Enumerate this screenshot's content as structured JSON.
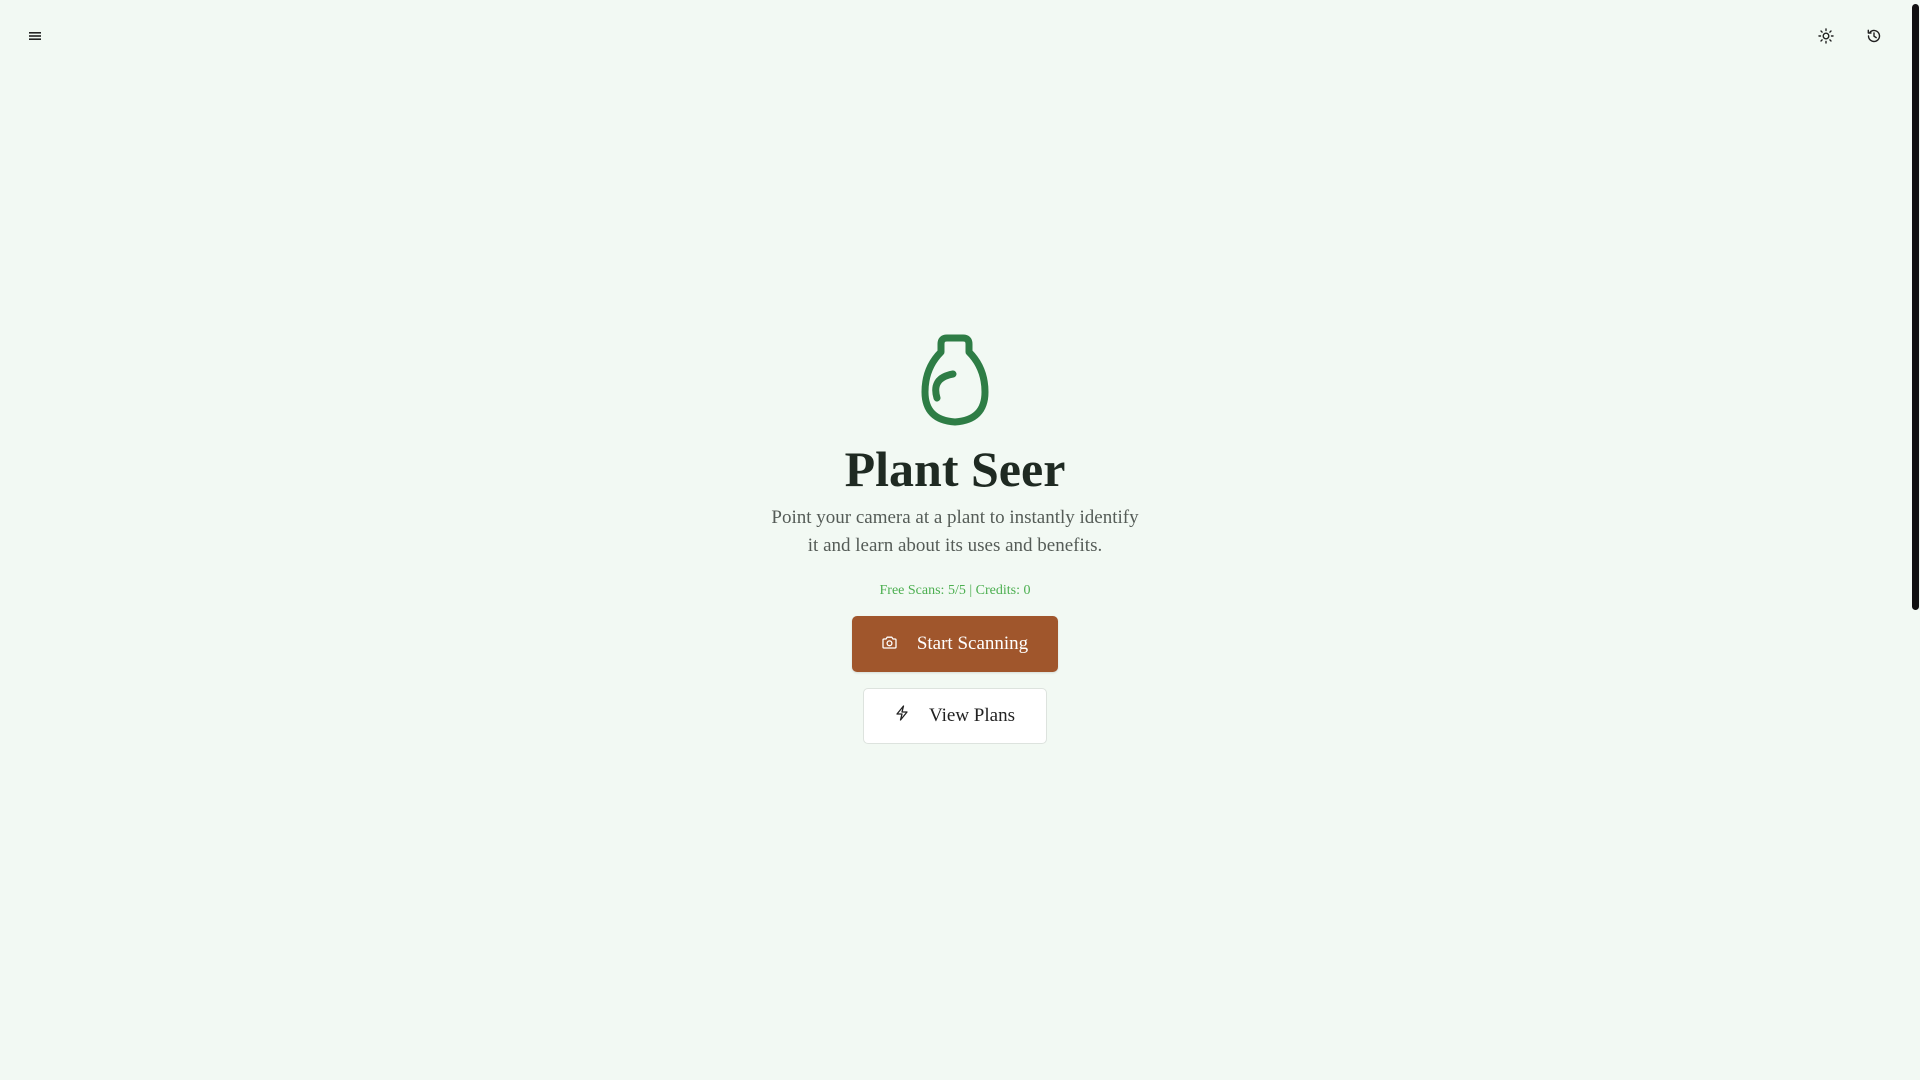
{
  "header": {
    "menu_icon": "menu-icon",
    "theme_icon": "sun-icon",
    "history_icon": "history-icon"
  },
  "hero": {
    "logo_icon": "leaf-icon",
    "title": "Plant Seer",
    "subtitle": "Point your camera at a plant to instantly identify it and learn about its uses and benefits.",
    "status": "Free Scans: 5/5 | Credits: 0",
    "start_label": "Start Scanning",
    "plans_label": "View Plans"
  },
  "colors": {
    "background": "#f2f9f3",
    "brand_green": "#2e7d45",
    "primary_button": "#a0562c",
    "status_text": "#4caf50"
  }
}
